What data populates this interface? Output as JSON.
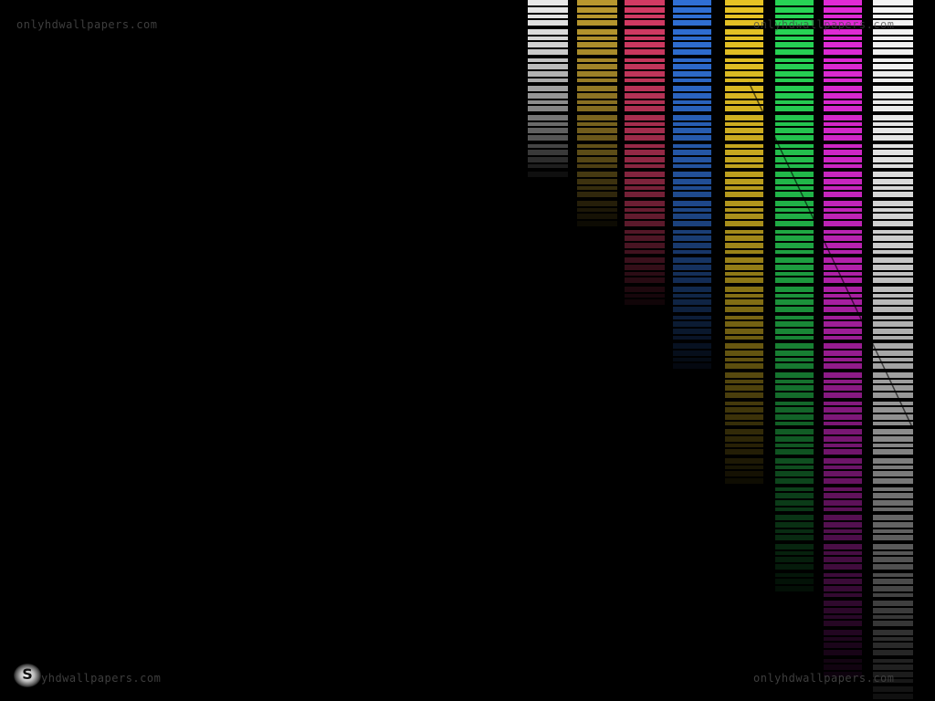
{
  "watermarks": {
    "top_left": "onlyhdwallpapers.com",
    "top_right": "onlyhdwallpapers.com",
    "bottom_left": "yhdwallpapers.com",
    "bottom_right": "onlyhdwallpapers.com"
  },
  "logo": {
    "letter": "S"
  },
  "colors": {
    "background": "#000000",
    "columns": [
      "#e8e8e8",
      "#b8972e",
      "#d23a63",
      "#2f6fd4",
      "#e6c224",
      "#27d455",
      "#e02ad6",
      "#f4f4f4"
    ]
  }
}
